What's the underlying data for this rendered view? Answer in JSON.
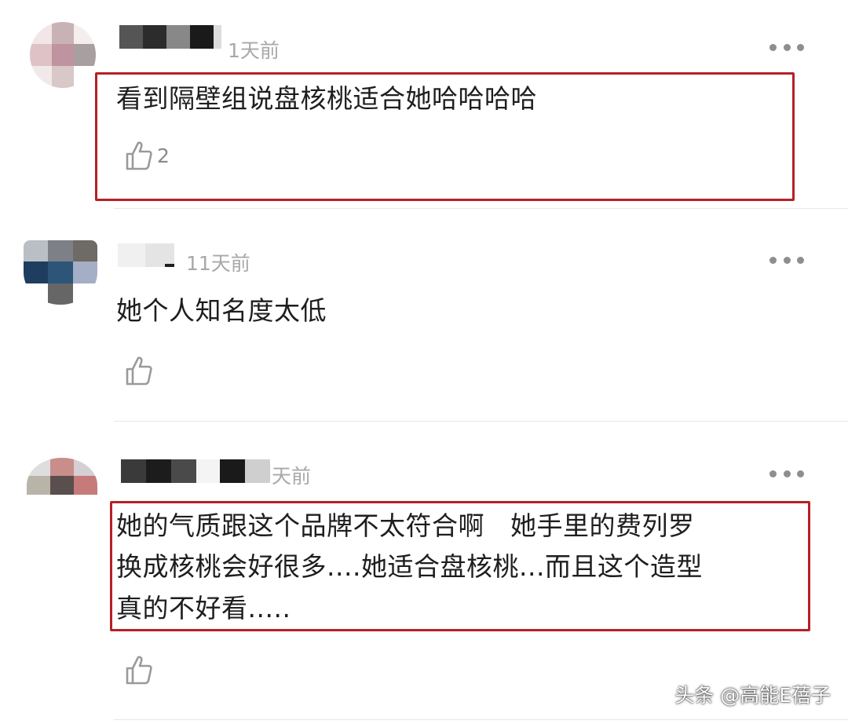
{
  "comments": [
    {
      "time": "1天前",
      "text": "看到隔壁组说盘核桃适合她哈哈哈哈",
      "like_count": "2",
      "highlighted": true,
      "avatar_colors": [
        "#f2e6e6",
        "#c9b2b6",
        "#f5eeee",
        "#dfc2c6",
        "#bf94a0",
        "#a8a0a0",
        "#f1e9e9",
        "#d8c8c8",
        "#ffffff"
      ],
      "name_colors": [
        "#555555",
        "#2c2c2c",
        "#888888",
        "#1a1a1a",
        "#dddddd"
      ]
    },
    {
      "time": "11天前",
      "text": "她个人知名度太低",
      "like_count": "",
      "highlighted": false,
      "avatar_colors": [
        "#b9bfc4",
        "#7d8087",
        "#6e6a64",
        "#1f3d5e",
        "#2c5578",
        "#a4aec4",
        "#ffffff",
        "#666666",
        "#ffffff"
      ],
      "name_colors": [
        "#f0f0f0",
        "#e4e4e4",
        "#202020"
      ]
    },
    {
      "time": "天前",
      "text_lines": [
        "她的气质跟这个品牌不太符合啊   她手里的费列罗",
        "换成核桃会好很多....她适合盘核桃...而且这个造型",
        "真的不好看....."
      ],
      "like_count": "",
      "highlighted": true,
      "avatar_colors": [
        "#dedede",
        "#c98e8a",
        "#d4d0d4",
        "#b8b4a8",
        "#5a4e4e",
        "#c67a7a",
        "#ffffff",
        "#ffffff",
        "#ffffff"
      ],
      "name_colors": [
        "#3a3a3a",
        "#1c1c1c",
        "#4a4a4a",
        "#f4f4f4",
        "#1a1a1a",
        "#cfcfcf"
      ]
    }
  ],
  "watermark": "头条 @高能E蓓子",
  "icons": {
    "more": "more-icon",
    "like": "thumbs-up-icon"
  },
  "colors": {
    "highlight_border": "#b52025",
    "time_text": "#a8a8a8",
    "like_icon": "#9a9a9a"
  }
}
